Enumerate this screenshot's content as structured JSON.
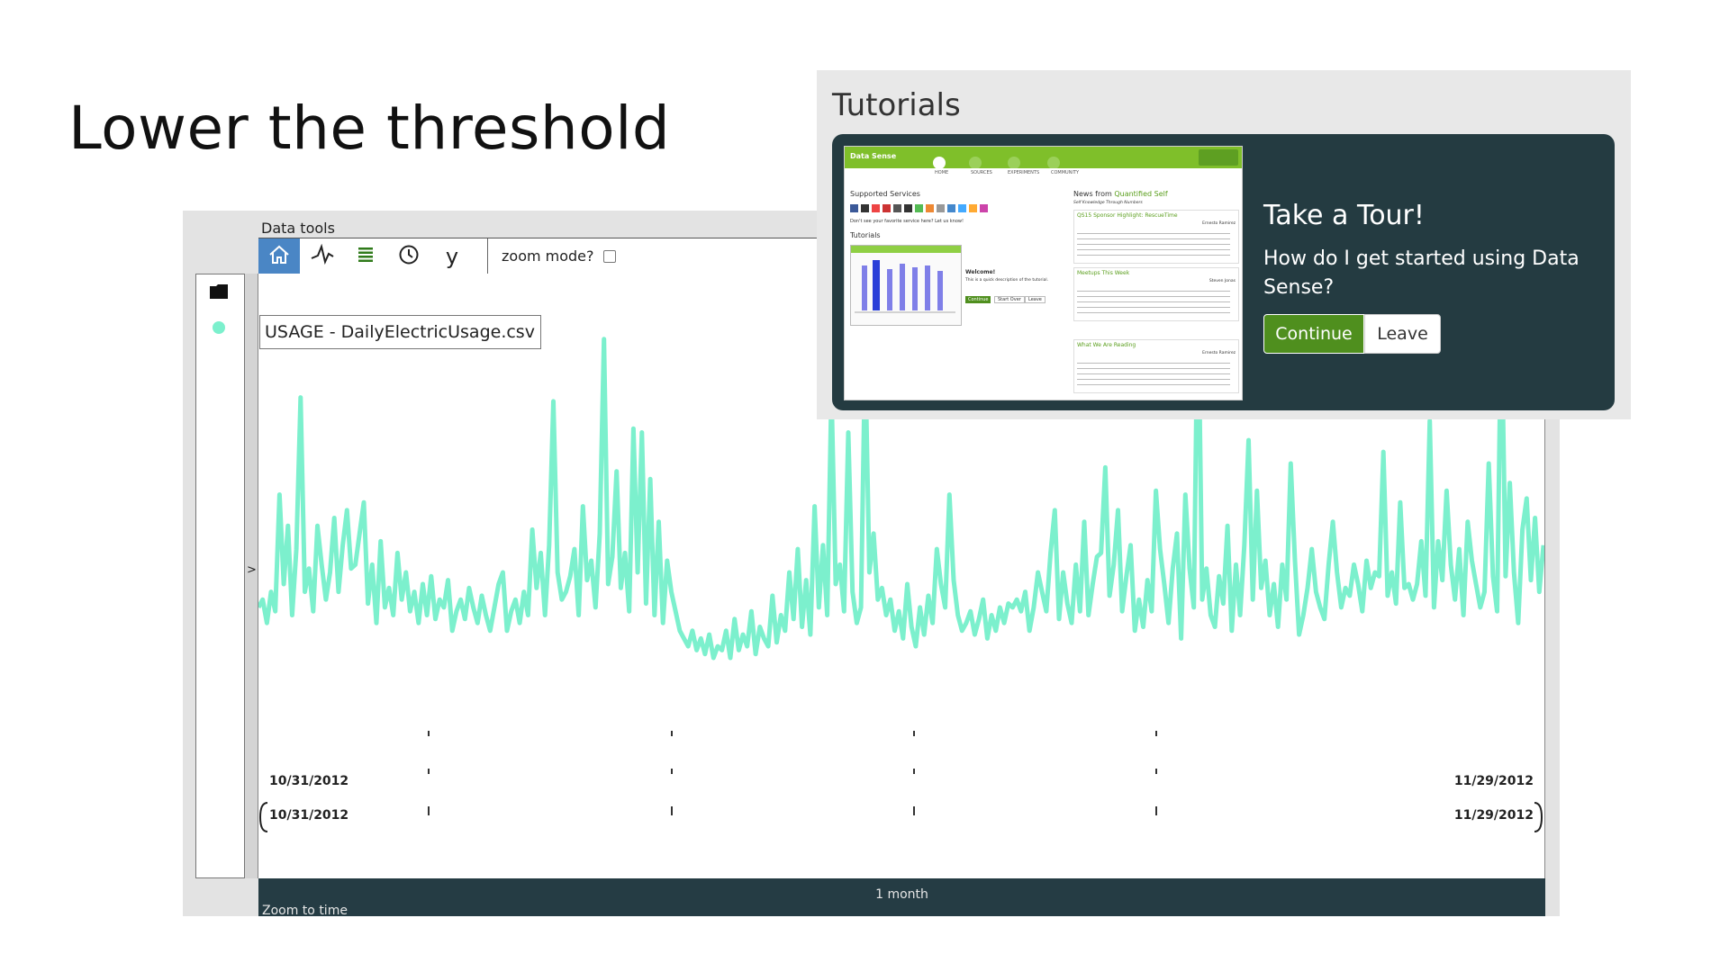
{
  "slide": {
    "title": "Lower the threshold"
  },
  "data_tools": {
    "label": "Data tools",
    "toolbar": {
      "home_icon": "home-icon",
      "line_tool_icon": "line-tool-icon",
      "list_icon": "list-icon",
      "clock_icon": "clock-icon",
      "y_label": "y",
      "zoom_mode_label": "zoom mode?",
      "zoom_mode_checked": false
    },
    "sidebar": {
      "folder_icon": "folder-icon",
      "status_color": "#7cf0cd",
      "collapse_label": ">"
    },
    "series_label": "USAGE - DailyElectricUsage.csv",
    "axis": {
      "start_date": "10/31/2012",
      "end_date": "11/29/2012",
      "brush_start": "10/31/2012",
      "brush_end": "11/29/2012",
      "range_label": "1 month",
      "zoom_to_time_label": "Zoom to time"
    },
    "colors": {
      "series": "#7cf0cd",
      "active_tool": "#4a86c5",
      "brush_bar": "#253c44"
    }
  },
  "chart_data": {
    "type": "line",
    "x_start": "10/31/2012",
    "x_end": "11/29/2012",
    "series": [
      {
        "values": [
          0.16,
          0.18,
          0.12,
          0.2,
          0.15,
          0.45,
          0.22,
          0.37,
          0.14,
          0.31,
          0.7,
          0.2,
          0.26,
          0.15,
          0.37,
          0.27,
          0.18,
          0.25,
          0.39,
          0.2,
          0.32,
          0.41,
          0.26,
          0.27,
          0.35,
          0.43,
          0.17,
          0.27,
          0.12,
          0.33,
          0.16,
          0.21,
          0.14,
          0.3,
          0.18,
          0.25,
          0.15,
          0.2,
          0.12,
          0.22,
          0.14,
          0.24,
          0.13,
          0.18,
          0.16,
          0.23,
          0.1,
          0.15,
          0.18,
          0.13,
          0.21,
          0.16,
          0.12,
          0.19,
          0.14,
          0.1,
          0.16,
          0.22,
          0.25,
          0.1,
          0.15,
          0.18,
          0.12,
          0.2,
          0.14,
          0.36,
          0.21,
          0.3,
          0.14,
          0.32,
          0.69,
          0.25,
          0.18,
          0.2,
          0.24,
          0.31,
          0.14,
          0.42,
          0.23,
          0.28,
          0.16,
          0.35,
          0.85,
          0.22,
          0.29,
          0.51,
          0.21,
          0.3,
          0.15,
          0.62,
          0.25,
          0.61,
          0.17,
          0.49,
          0.14,
          0.38,
          0.12,
          0.28,
          0.2,
          0.15,
          0.1,
          0.08,
          0.06,
          0.1,
          0.05,
          0.08,
          0.04,
          0.09,
          0.03,
          0.06,
          0.05,
          0.1,
          0.03,
          0.13,
          0.05,
          0.09,
          0.06,
          0.15,
          0.04,
          0.11,
          0.08,
          0.06,
          0.19,
          0.07,
          0.14,
          0.1,
          0.25,
          0.13,
          0.31,
          0.11,
          0.23,
          0.09,
          0.42,
          0.16,
          0.32,
          0.14,
          0.72,
          0.22,
          0.27,
          0.15,
          0.61,
          0.2,
          0.12,
          0.16,
          0.82,
          0.25,
          0.35,
          0.18,
          0.21,
          0.14,
          0.18,
          0.1,
          0.15,
          0.08,
          0.22,
          0.11,
          0.06,
          0.16,
          0.09,
          0.19,
          0.12,
          0.31,
          0.22,
          0.16,
          0.45,
          0.23,
          0.14,
          0.1,
          0.12,
          0.15,
          0.09,
          0.13,
          0.18,
          0.08,
          0.14,
          0.1,
          0.16,
          0.12,
          0.17,
          0.16,
          0.18,
          0.15,
          0.2,
          0.1,
          0.16,
          0.25,
          0.2,
          0.15,
          0.3,
          0.41,
          0.13,
          0.25,
          0.17,
          0.12,
          0.27,
          0.15,
          0.38,
          0.14,
          0.22,
          0.29,
          0.3,
          0.52,
          0.19,
          0.27,
          0.41,
          0.15,
          0.24,
          0.32,
          0.1,
          0.18,
          0.11,
          0.23,
          0.15,
          0.46,
          0.31,
          0.22,
          0.12,
          0.26,
          0.35,
          0.08,
          0.45,
          0.26,
          0.16,
          1.0,
          0.18,
          0.26,
          0.14,
          0.11,
          0.24,
          0.17,
          0.37,
          0.1,
          0.27,
          0.14,
          0.32,
          0.59,
          0.18,
          0.46,
          0.21,
          0.28,
          0.14,
          0.22,
          0.11,
          0.27,
          0.18,
          0.53,
          0.28,
          0.09,
          0.14,
          0.21,
          0.31,
          0.2,
          0.16,
          0.13,
          0.27,
          0.38,
          0.25,
          0.16,
          0.21,
          0.19,
          0.27,
          0.22,
          0.15,
          0.28,
          0.21,
          0.25,
          0.24,
          0.56,
          0.19,
          0.25,
          0.17,
          0.43,
          0.21,
          0.22,
          0.18,
          0.22,
          0.33,
          0.19,
          0.64,
          0.16,
          0.33,
          0.23,
          0.46,
          0.27,
          0.18,
          0.31,
          0.14,
          0.38,
          0.28,
          0.22,
          0.16,
          0.2,
          0.53,
          0.24,
          0.15,
          0.94,
          0.24,
          0.48,
          0.25,
          0.12,
          0.36,
          0.44,
          0.23,
          0.39,
          0.2,
          0.32
        ]
      }
    ]
  },
  "tutorials": {
    "heading": "Tutorials",
    "card": {
      "title": "Take a Tour!",
      "question": "How do I get started using Data Sense?",
      "continue_label": "Continue",
      "leave_label": "Leave"
    },
    "thumbnail": {
      "brand": "Data Sense",
      "nav": [
        "HOME",
        "SOURCES",
        "EXPERIMENTS",
        "COMMUNITY"
      ],
      "supported_services": "Supported Services",
      "favorite_service_note": "Don't see your favorite service here? Let us know!",
      "tutorials_label": "Tutorials",
      "welcome_title": "Welcome!",
      "welcome_text": "This is a quick description of the tutorial.",
      "continue_label": "Continue",
      "start_over_label": "Start Over",
      "leave_label": "Leave",
      "news_prefix": "News from",
      "news_source": "Quantified Self",
      "news_subtitle": "Self Knowledge Through Numbers",
      "news_items": [
        {
          "title": "QS15 Sponsor Highlight: RescueTime",
          "author": "Ernesto Ramirez"
        },
        {
          "title": "Meetups This Week",
          "author": "Steven Jonas"
        },
        {
          "title": "What We Are Reading",
          "author": "Ernesto Ramirez"
        }
      ]
    },
    "colors": {
      "card_bg": "#243b41",
      "continue_bg": "#4f8f1e",
      "brand_green": "#7fbf2a"
    }
  }
}
